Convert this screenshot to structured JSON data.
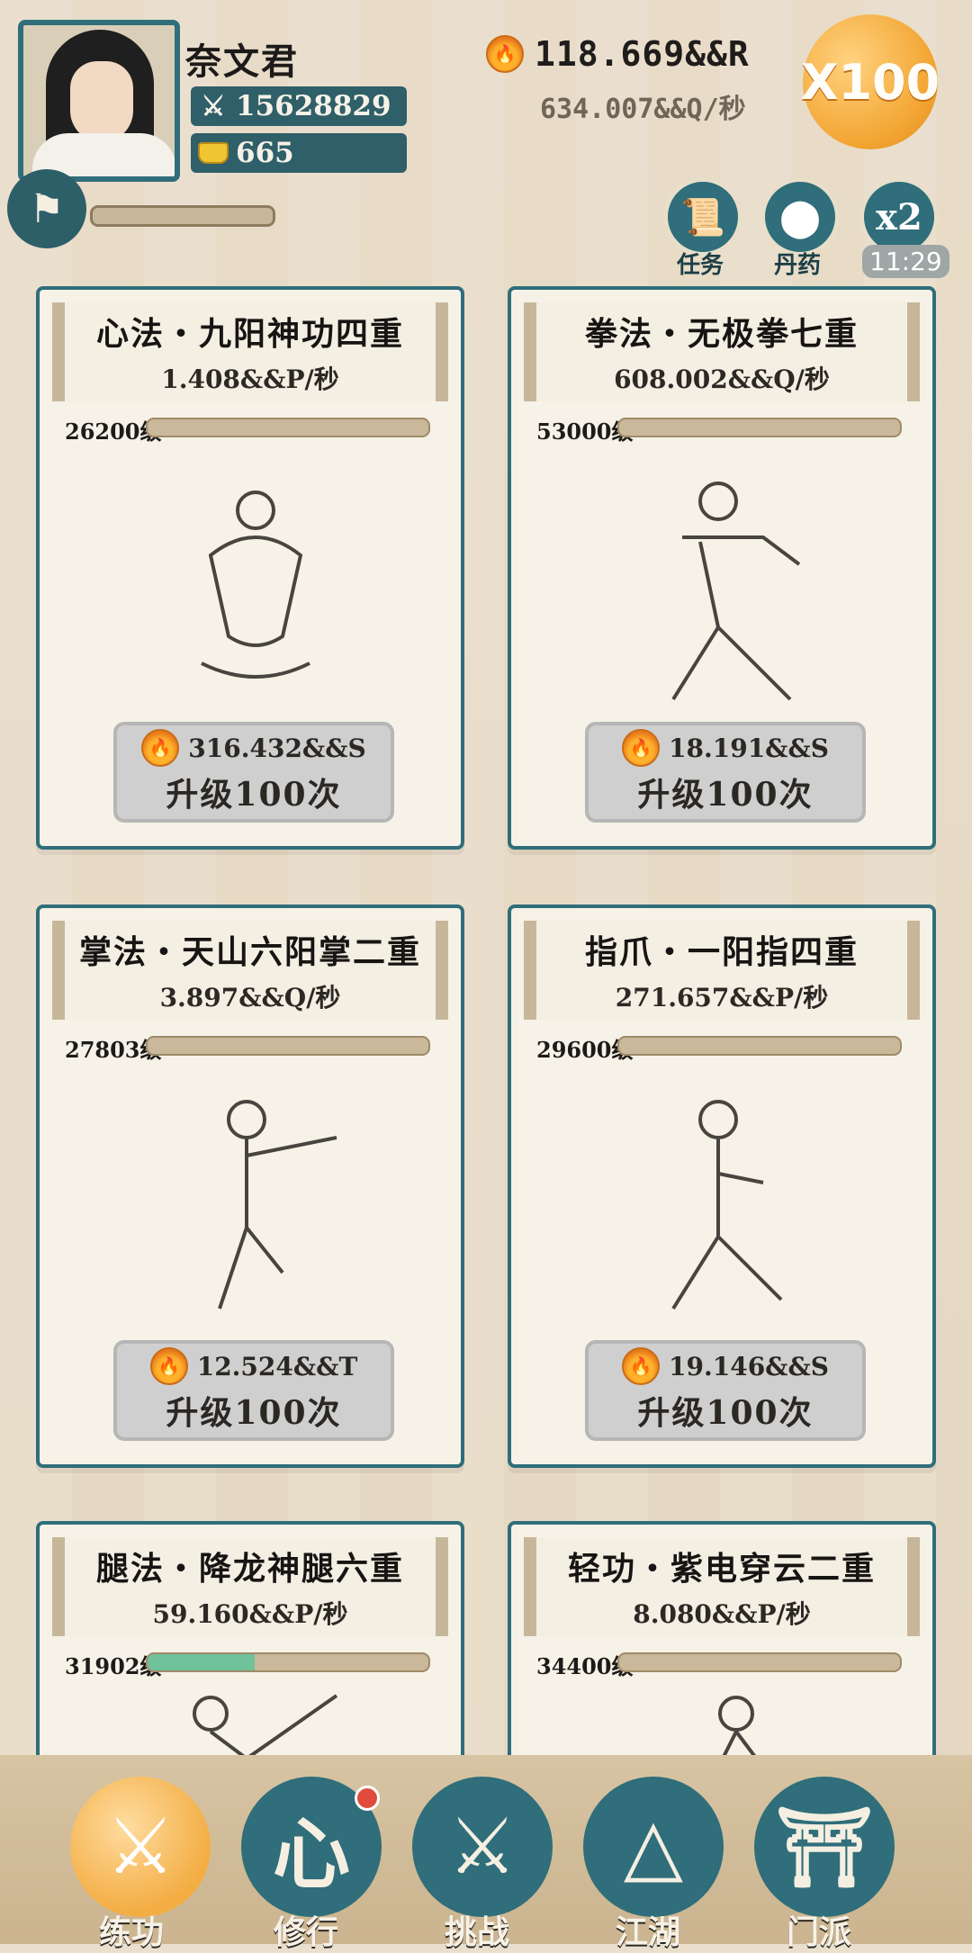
{
  "header": {
    "player_name": "奈文君",
    "power": "15628829",
    "gold": "665",
    "coins_total": "118.669&&R",
    "coins_rate": "634.007&&Q/秒",
    "multiplier_label": "X100",
    "shortcuts": [
      {
        "label": "任务",
        "icon": "scroll-icon"
      },
      {
        "label": "丹药",
        "icon": "pill-icon"
      },
      {
        "label": "x2",
        "icon": "x2-icon"
      }
    ],
    "timer": "11:29"
  },
  "cards": [
    {
      "title": "心法・九阳神功四重",
      "rate": "1.408&&P/秒",
      "level": "26200级",
      "progress": 0.0,
      "cost": "316.432&&S",
      "upgrade": "升级100次"
    },
    {
      "title": "拳法・无极拳七重",
      "rate": "608.002&&Q/秒",
      "level": "53000级",
      "progress": 0.0,
      "cost": "18.191&&S",
      "upgrade": "升级100次"
    },
    {
      "title": "掌法・天山六阳掌二重",
      "rate": "3.897&&Q/秒",
      "level": "27803级",
      "progress": 0.0,
      "cost": "12.524&&T",
      "upgrade": "升级100次"
    },
    {
      "title": "指爪・一阳指四重",
      "rate": "271.657&&P/秒",
      "level": "29600级",
      "progress": 0.0,
      "cost": "19.146&&S",
      "upgrade": "升级100次"
    },
    {
      "title": "腿法・降龙神腿六重",
      "rate": "59.160&&P/秒",
      "level": "31902级",
      "progress": 0.38,
      "cost": "",
      "upgrade": ""
    },
    {
      "title": "轻功・紫电穿云二重",
      "rate": "8.080&&P/秒",
      "level": "34400级",
      "progress": 0.0,
      "cost": "",
      "upgrade": ""
    }
  ],
  "nav": [
    {
      "label": "练功",
      "icon": "kungfu-icon",
      "active": true
    },
    {
      "label": "修行",
      "icon": "heart-icon",
      "active": false,
      "badge": true
    },
    {
      "label": "挑战",
      "icon": "swords-icon",
      "active": false
    },
    {
      "label": "江湖",
      "icon": "mountain-icon",
      "active": false
    },
    {
      "label": "门派",
      "icon": "gate-icon",
      "active": false
    }
  ],
  "colors": {
    "background": "#e9dfcc",
    "teal": "#2f6e7a",
    "orange": "#f3ad43",
    "progress_fill": "#6fc29a"
  }
}
